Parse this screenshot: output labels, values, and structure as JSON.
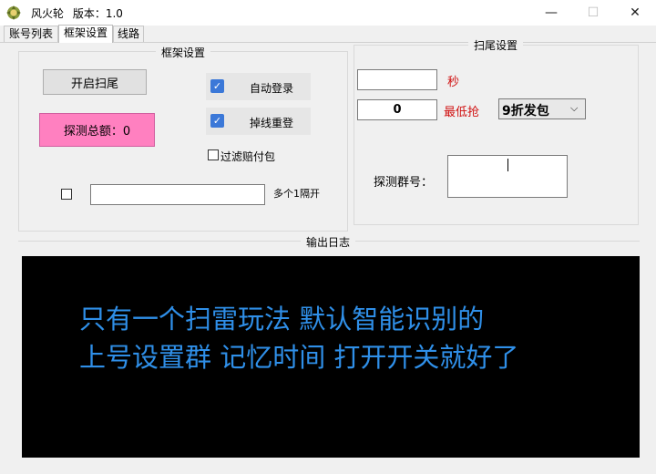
{
  "window": {
    "title": "风火轮",
    "version_label": "版本：1.0",
    "minimize": "—",
    "maximize": "☐",
    "close": "✕"
  },
  "tabs": [
    {
      "label": "账号列表"
    },
    {
      "label": "框架设置"
    },
    {
      "label": "线路"
    }
  ],
  "frame_settings": {
    "legend": "框架设置",
    "start_button": "开启扫尾",
    "detect_total": "探测总额：0",
    "auto_login": {
      "label": "自动登录",
      "checked": true
    },
    "reconnect": {
      "label": "掉线重登",
      "checked": true
    },
    "filter_payout": {
      "label": "过滤赔付包",
      "checked": false
    },
    "multi_field_value": "",
    "multi_hint": "多个1隔开"
  },
  "tail_settings": {
    "legend": "扫尾设置",
    "seconds_value": "",
    "seconds_label": "秒",
    "min_grab_value": "0",
    "min_grab_label": "最低抢",
    "package_select": "9折发包",
    "detect_group_label": "探测群号：",
    "detect_group_value": ""
  },
  "log": {
    "legend": "输出日志",
    "lines": [
      "只有一个扫雷玩法 默认智能识别的",
      "上号设置群 记忆时间 打开开关就好了"
    ]
  },
  "colors": {
    "accent": "#3b78d8",
    "pink": "#ff80c0",
    "red_label": "#d01010",
    "log_text": "#2f8fe8"
  }
}
